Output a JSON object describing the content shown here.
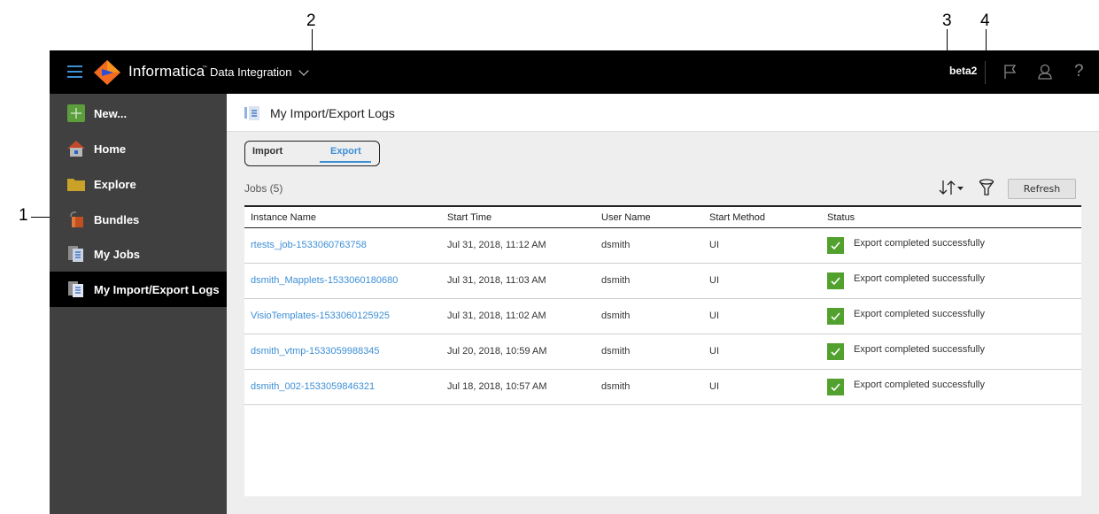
{
  "callouts": [
    "1",
    "2",
    "3",
    "4"
  ],
  "header": {
    "brand": "Informatica",
    "product": "Data Integration",
    "org": "beta2",
    "icons": [
      "menu-icon",
      "flag-icon",
      "user-icon",
      "help-icon"
    ]
  },
  "sidebar": {
    "items": [
      {
        "label": "New...",
        "icon": "plus-icon",
        "active": false
      },
      {
        "label": "Home",
        "icon": "home-icon",
        "active": false
      },
      {
        "label": "Explore",
        "icon": "folder-icon",
        "active": false
      },
      {
        "label": "Bundles",
        "icon": "bundle-icon",
        "active": false
      },
      {
        "label": "My Jobs",
        "icon": "jobs-icon",
        "active": false
      },
      {
        "label": "My Import/Export Logs",
        "icon": "logs-icon",
        "active": true
      }
    ]
  },
  "page": {
    "title": "My Import/Export Logs",
    "tabs": [
      {
        "label": "Import",
        "active": false
      },
      {
        "label": "Export",
        "active": true
      }
    ],
    "jobs_count": "Jobs (5)",
    "refresh_label": "Refresh"
  },
  "table": {
    "columns": [
      "Instance Name",
      "Start Time",
      "User Name",
      "Start Method",
      "Status"
    ],
    "rows": [
      {
        "instance": "rtests_job-1533060763758",
        "start_time": "Jul 31, 2018, 11:12 AM",
        "user": "dsmith",
        "method": "UI",
        "status": "Export completed successfully"
      },
      {
        "instance": "dsmith_Mapplets-1533060180680",
        "start_time": "Jul 31, 2018, 11:03 AM",
        "user": "dsmith",
        "method": "UI",
        "status": "Export completed successfully"
      },
      {
        "instance": "VisioTemplates-1533060125925",
        "start_time": "Jul 31, 2018, 11:02 AM",
        "user": "dsmith",
        "method": "UI",
        "status": "Export completed successfully"
      },
      {
        "instance": "dsmith_vtmp-1533059988345",
        "start_time": "Jul 20, 2018, 10:59 AM",
        "user": "dsmith",
        "method": "UI",
        "status": "Export completed successfully"
      },
      {
        "instance": "dsmith_002-1533059846321",
        "start_time": "Jul 18, 2018, 10:57 AM",
        "user": "dsmith",
        "method": "UI",
        "status": "Export completed successfully"
      }
    ]
  },
  "colors": {
    "accent": "#3d8fd6",
    "success": "#52a12e",
    "topbar": "#000000",
    "sidebar": "#404041"
  }
}
